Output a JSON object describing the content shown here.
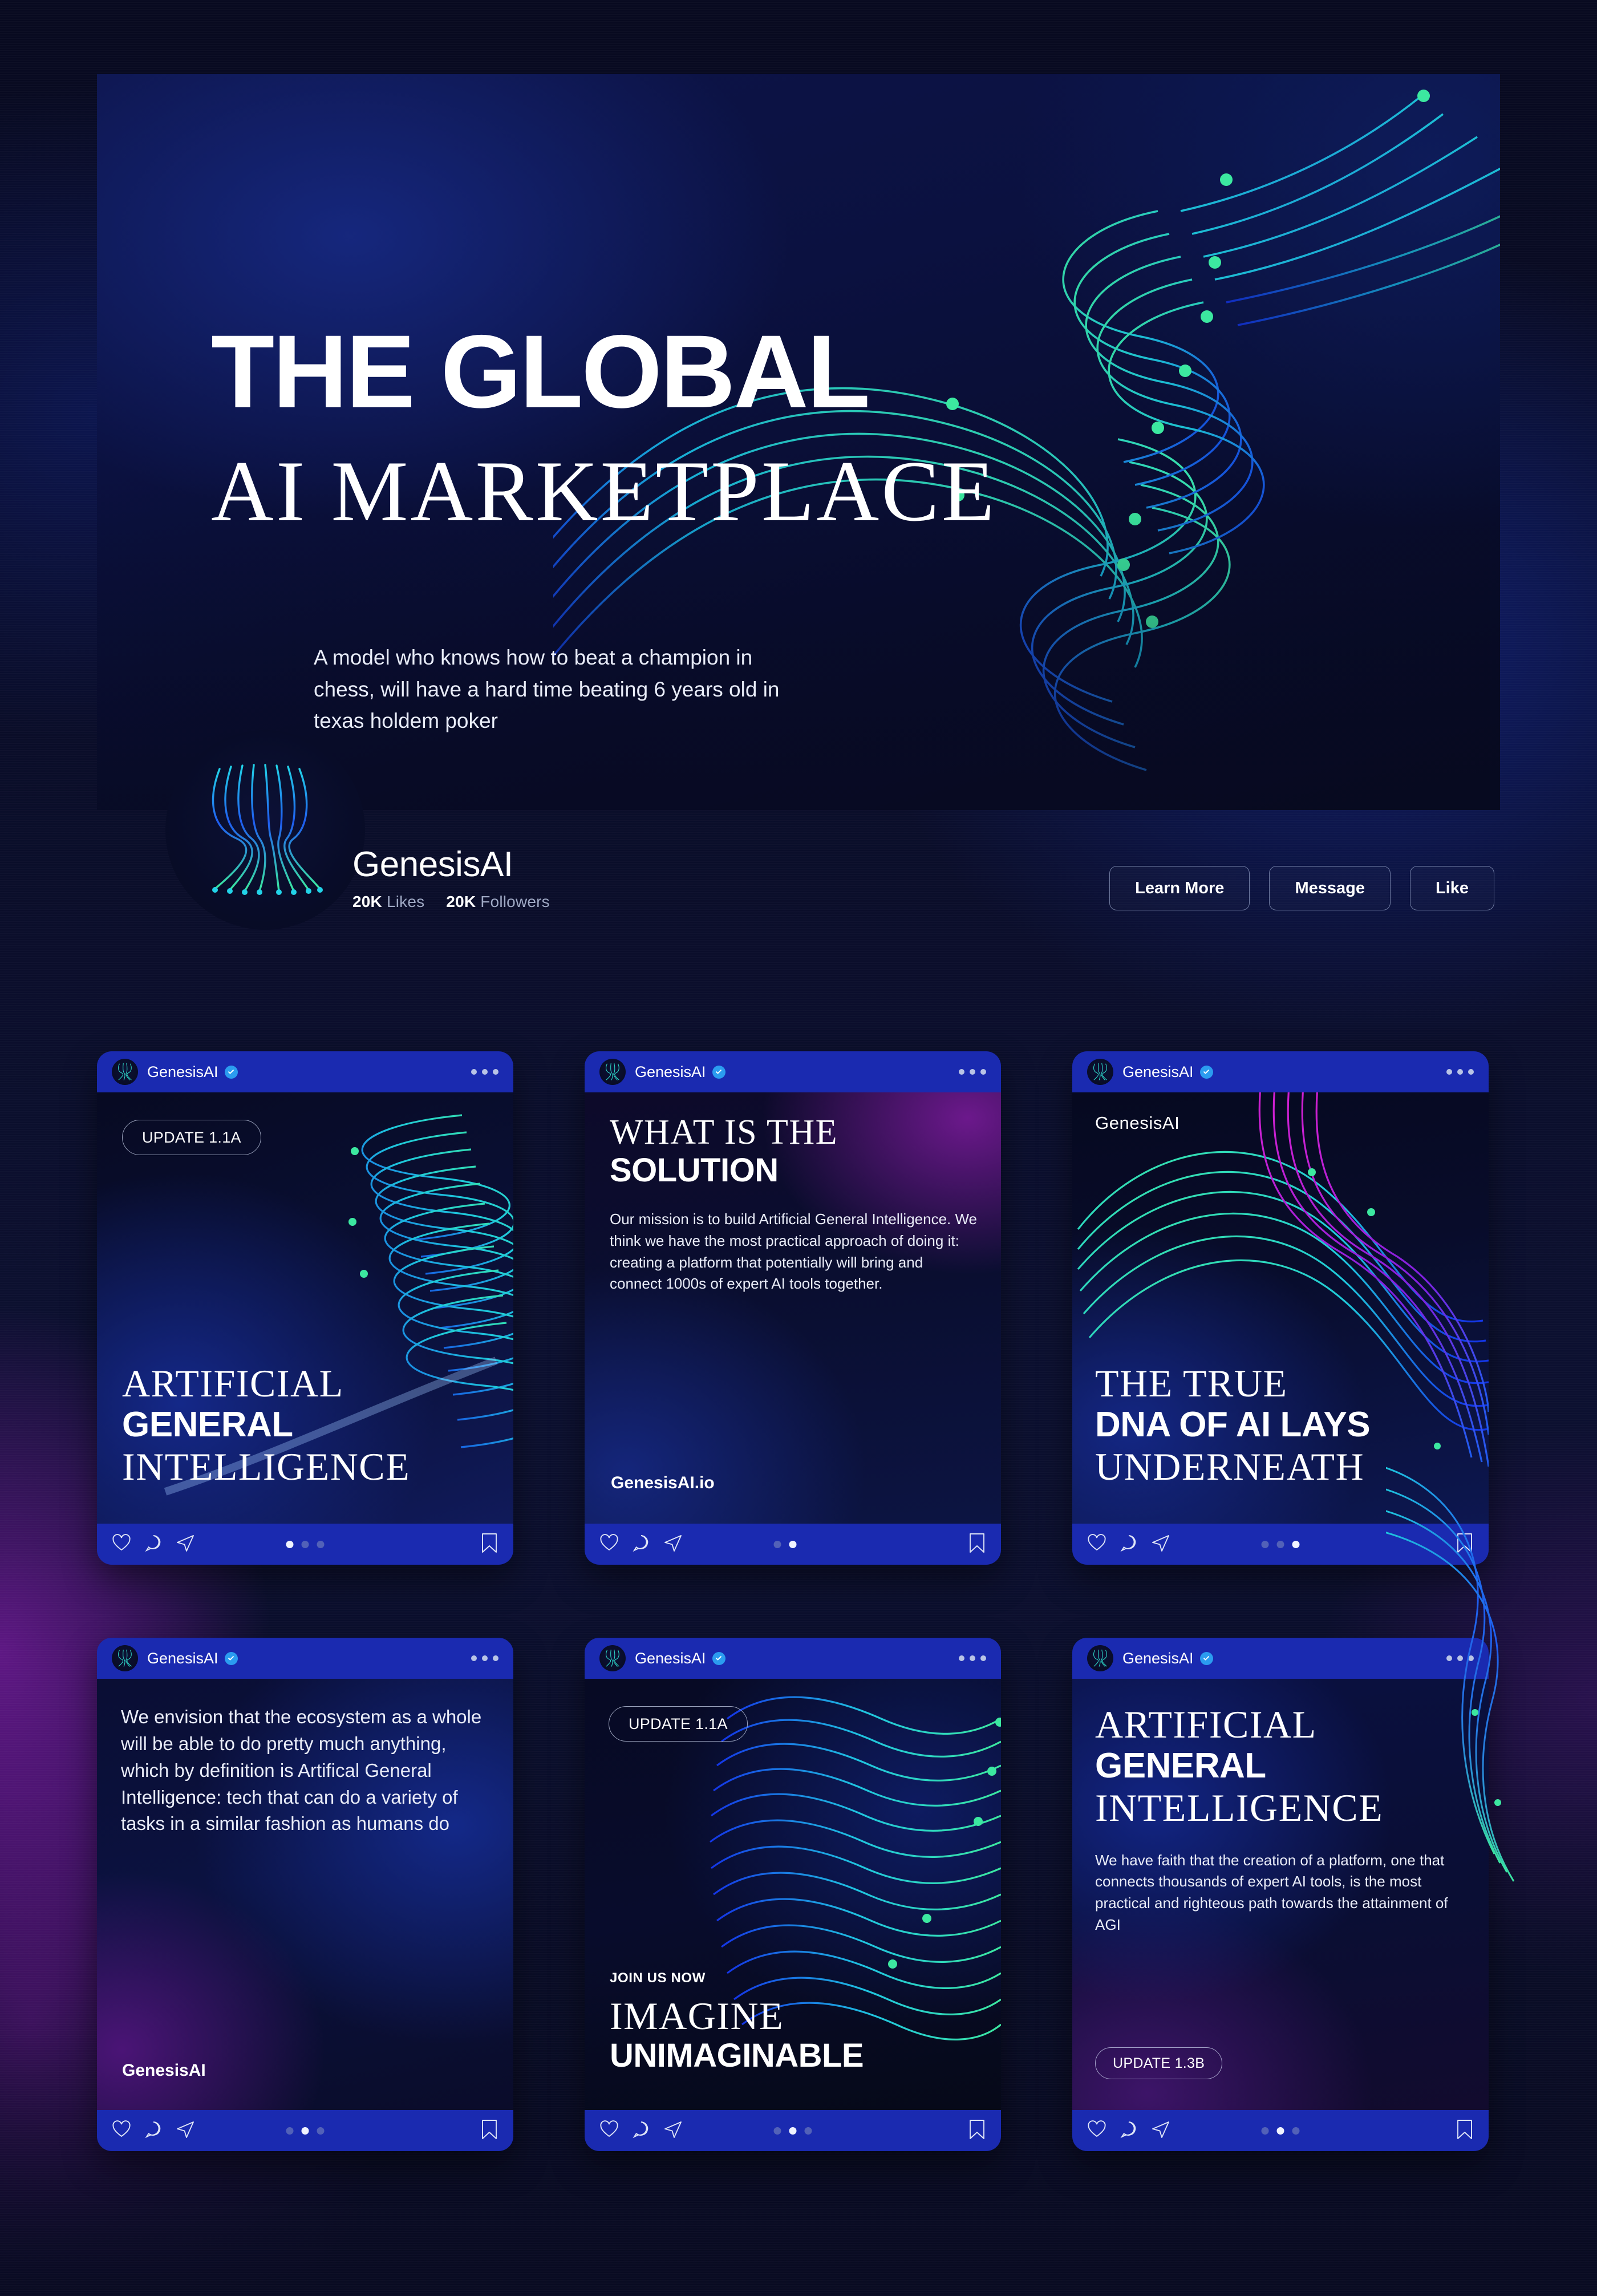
{
  "hero": {
    "title_line1": "THE GLOBAL",
    "title_line2": "AI MARKETPLACE",
    "subtitle": "A model who knows how to beat a champion in chess, will have a hard time beating 6 years old in texas holdem poker"
  },
  "profile": {
    "name": "GenesisAI",
    "likes_value": "20K",
    "likes_label": "Likes",
    "followers_value": "20K",
    "followers_label": "Followers",
    "actions": [
      {
        "label": "Learn More"
      },
      {
        "label": "Message"
      },
      {
        "label": "Like"
      }
    ]
  },
  "post_header": {
    "account": "GenesisAI",
    "verified_icon": "verified-badge-icon",
    "menu_icon": "more-options-icon"
  },
  "post_footer": {
    "like_icon": "heart-icon",
    "comment_icon": "comment-icon",
    "share_icon": "share-icon",
    "save_icon": "bookmark-icon"
  },
  "cards": [
    {
      "id": "card-agi-update",
      "badge": "UPDATE 1.1A",
      "headline_serif_1": "ARTIFICIAL",
      "headline_bold": "GENERAL",
      "headline_serif_2": "INTELLIGENCE",
      "active_dot": 0
    },
    {
      "id": "card-solution",
      "title_serif": "WHAT IS THE",
      "title_bold": "SOLUTION",
      "body": "Our mission is to build Artificial General Intelligence. We think we have the most practical approach of doing it: creating a platform that potentially will bring and connect 1000s of expert AI tools together.",
      "footer_url": "GenesisAI.io",
      "active_dot": 1
    },
    {
      "id": "card-dna",
      "watermark": "GenesisAI",
      "headline_serif_1": "THE TRUE",
      "headline_bold": "DNA OF AI LAYS",
      "headline_serif_2": "UNDERNEATH",
      "active_dot": 2
    },
    {
      "id": "card-envision",
      "body": "We envision that the ecosystem as a whole will be able to do pretty much anything, which by definition is Artifical General Intelligence: tech that can do a variety of tasks in a similar fashion as humans do",
      "watermark": "GenesisAI",
      "active_dot": 1
    },
    {
      "id": "card-imagine",
      "badge": "UPDATE 1.1A",
      "eyebrow": "JOIN US NOW",
      "headline_serif": "IMAGINE",
      "headline_bold": "UNIMAGINABLE",
      "active_dot": 1
    },
    {
      "id": "card-faith",
      "headline_serif_1": "ARTIFICIAL",
      "headline_bold": "GENERAL",
      "headline_serif_2": "INTELLIGENCE",
      "body": "We have faith that the creation of a platform, one that connects thousands of expert AI tools, is the most practical and righteous path towards the  attainment of AGI",
      "badge": "UPDATE 1.3B",
      "active_dot": 1
    }
  ],
  "colors": {
    "accent_blue": "#1a2ab0",
    "verified_blue": "#2b9cf0",
    "line_green": "#3ce8a0",
    "line_cyan": "#22d3e8",
    "line_blue": "#1f5cf0",
    "line_magenta": "#d020d0",
    "page_bg": "#0a0c26"
  }
}
